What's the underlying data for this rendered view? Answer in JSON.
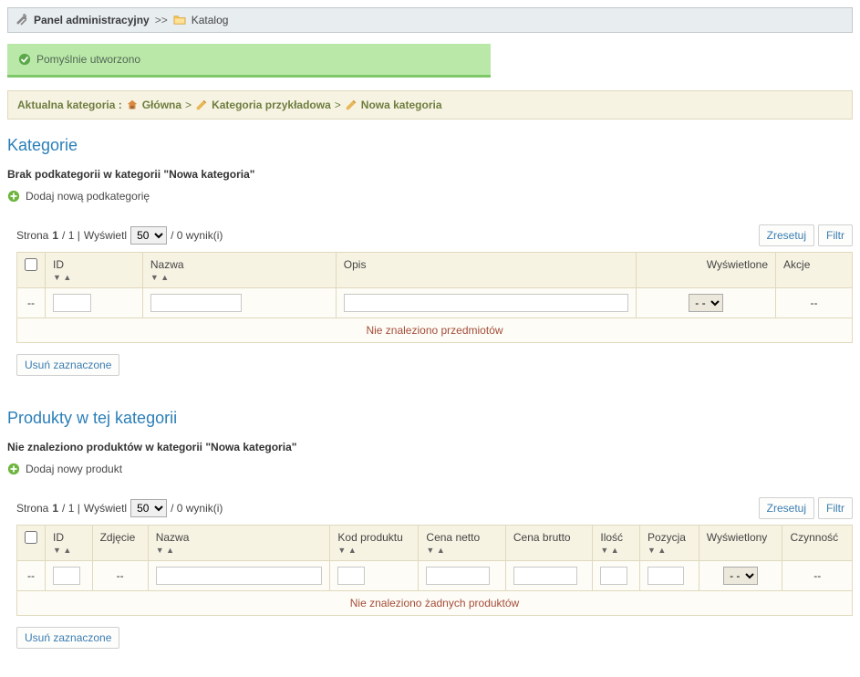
{
  "breadcrumb": {
    "title": "Panel administracyjny",
    "sep": ">>",
    "current": "Katalog"
  },
  "success": {
    "message": "Pomyślnie utworzono"
  },
  "category_path": {
    "label": "Aktualna kategoria :",
    "home": "Główna",
    "sep": ">",
    "cat1": "Kategoria przykładowa",
    "cat2": "Nowa kategoria"
  },
  "categories": {
    "title": "Kategorie",
    "no_sub": "Brak podkategorii w kategorii \"Nowa kategoria\"",
    "add_label": "Dodaj nową podkategorię",
    "pager": {
      "page_text_a": "Strona",
      "page_num": "1",
      "page_text_b": "/ 1 |",
      "display_label": "Wyświetl",
      "per_page": "50",
      "result_text": "/ 0 wynik(i)"
    },
    "reset_btn": "Zresetuj",
    "filter_btn": "Filtr",
    "headers": {
      "id": "ID",
      "name": "Nazwa",
      "desc": "Opis",
      "displayed": "Wyświetlone",
      "actions": "Akcje"
    },
    "dash": "--",
    "select_placeholder": "- -",
    "no_items": "Nie znaleziono przedmiotów",
    "delete_btn": "Usuń zaznaczone"
  },
  "products": {
    "title": "Produkty w tej kategorii",
    "no_prod": "Nie znaleziono produktów w kategorii \"Nowa kategoria\"",
    "add_label": "Dodaj nowy produkt",
    "pager": {
      "page_text_a": "Strona",
      "page_num": "1",
      "page_text_b": "/ 1 |",
      "display_label": "Wyświetl",
      "per_page": "50",
      "result_text": "/ 0 wynik(i)"
    },
    "reset_btn": "Zresetuj",
    "filter_btn": "Filtr",
    "headers": {
      "id": "ID",
      "photo": "Zdjęcie",
      "name": "Nazwa",
      "code": "Kod produktu",
      "net": "Cena netto",
      "gross": "Cena brutto",
      "qty": "Ilość",
      "pos": "Pozycja",
      "displayed": "Wyświetlony",
      "actions": "Czynność"
    },
    "dash": "--",
    "select_placeholder": "- -",
    "no_items": "Nie znaleziono żadnych produktów",
    "delete_btn": "Usuń zaznaczone"
  }
}
